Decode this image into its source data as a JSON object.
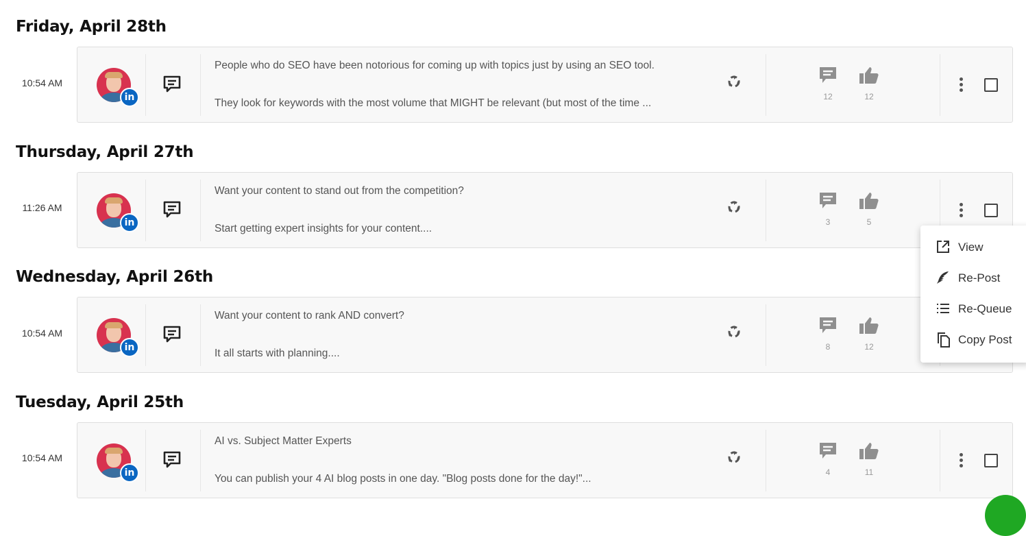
{
  "posts": [
    {
      "day": "Friday, April 28th",
      "time": "10:54 AM",
      "line1": "People who do SEO have been notorious for coming up with topics just by using an SEO tool.",
      "line2": "They look for keywords with the most volume that MIGHT be relevant (but most of the time ...",
      "comments": "12",
      "likes": "12"
    },
    {
      "day": "Thursday, April 27th",
      "time": "11:26 AM",
      "line1": "Want your content to stand out from the competition?",
      "line2": "Start getting expert insights for your content....",
      "comments": "3",
      "likes": "5"
    },
    {
      "day": "Wednesday, April 26th",
      "time": "10:54 AM",
      "line1": "Want your content to rank AND convert?",
      "line2": "It all starts with planning....",
      "comments": "8",
      "likes": "12"
    },
    {
      "day": "Tuesday, April 25th",
      "time": "10:54 AM",
      "line1": "AI vs. Subject Matter Experts",
      "line2": "You can publish your 4 AI blog posts in one day. \"Blog posts done for the day!\"...",
      "comments": "4",
      "likes": "11"
    }
  ],
  "context_menu": {
    "view": "View",
    "repost": "Re-Post",
    "requeue": "Re-Queue",
    "copy": "Copy Post"
  },
  "badge": "in",
  "colors": {
    "linkedin": "#0a66c2",
    "avatar_bg": "#d8324f",
    "icon_gray": "#8f8f8f",
    "fab_green": "#1fa823"
  }
}
